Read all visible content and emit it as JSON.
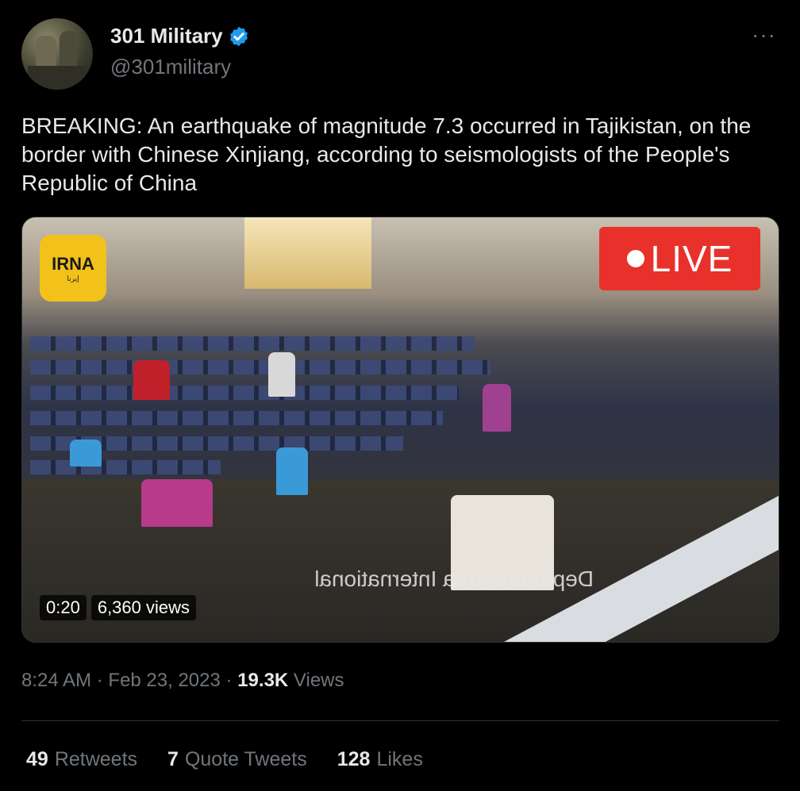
{
  "author": {
    "display_name": "301 Military",
    "handle": "@301military",
    "verified_icon": "verified-badge-icon",
    "verified_color": "#1d9bf0"
  },
  "more_icon": "···",
  "tweet": {
    "text": "BREAKING: An earthquake of magnitude 7.3 occurred in Tajikistan, on the border with Chinese Xinjiang, according to seismologists of the People's Republic of China"
  },
  "media": {
    "watermark": "IRNA",
    "watermark_sub": "إيرنا",
    "live_label": "LIVE",
    "live_color": "#e8312a",
    "mirrored_caption": "Departure Area International",
    "duration": "0:20",
    "views": "6,360 views"
  },
  "meta": {
    "time": "8:24 AM",
    "date": "Feb 23, 2023",
    "views_count": "19.3K",
    "views_label": "Views",
    "separator": "·"
  },
  "stats": {
    "retweets_count": "49",
    "retweets_label": "Retweets",
    "quotes_count": "7",
    "quotes_label": "Quote Tweets",
    "likes_count": "128",
    "likes_label": "Likes"
  }
}
